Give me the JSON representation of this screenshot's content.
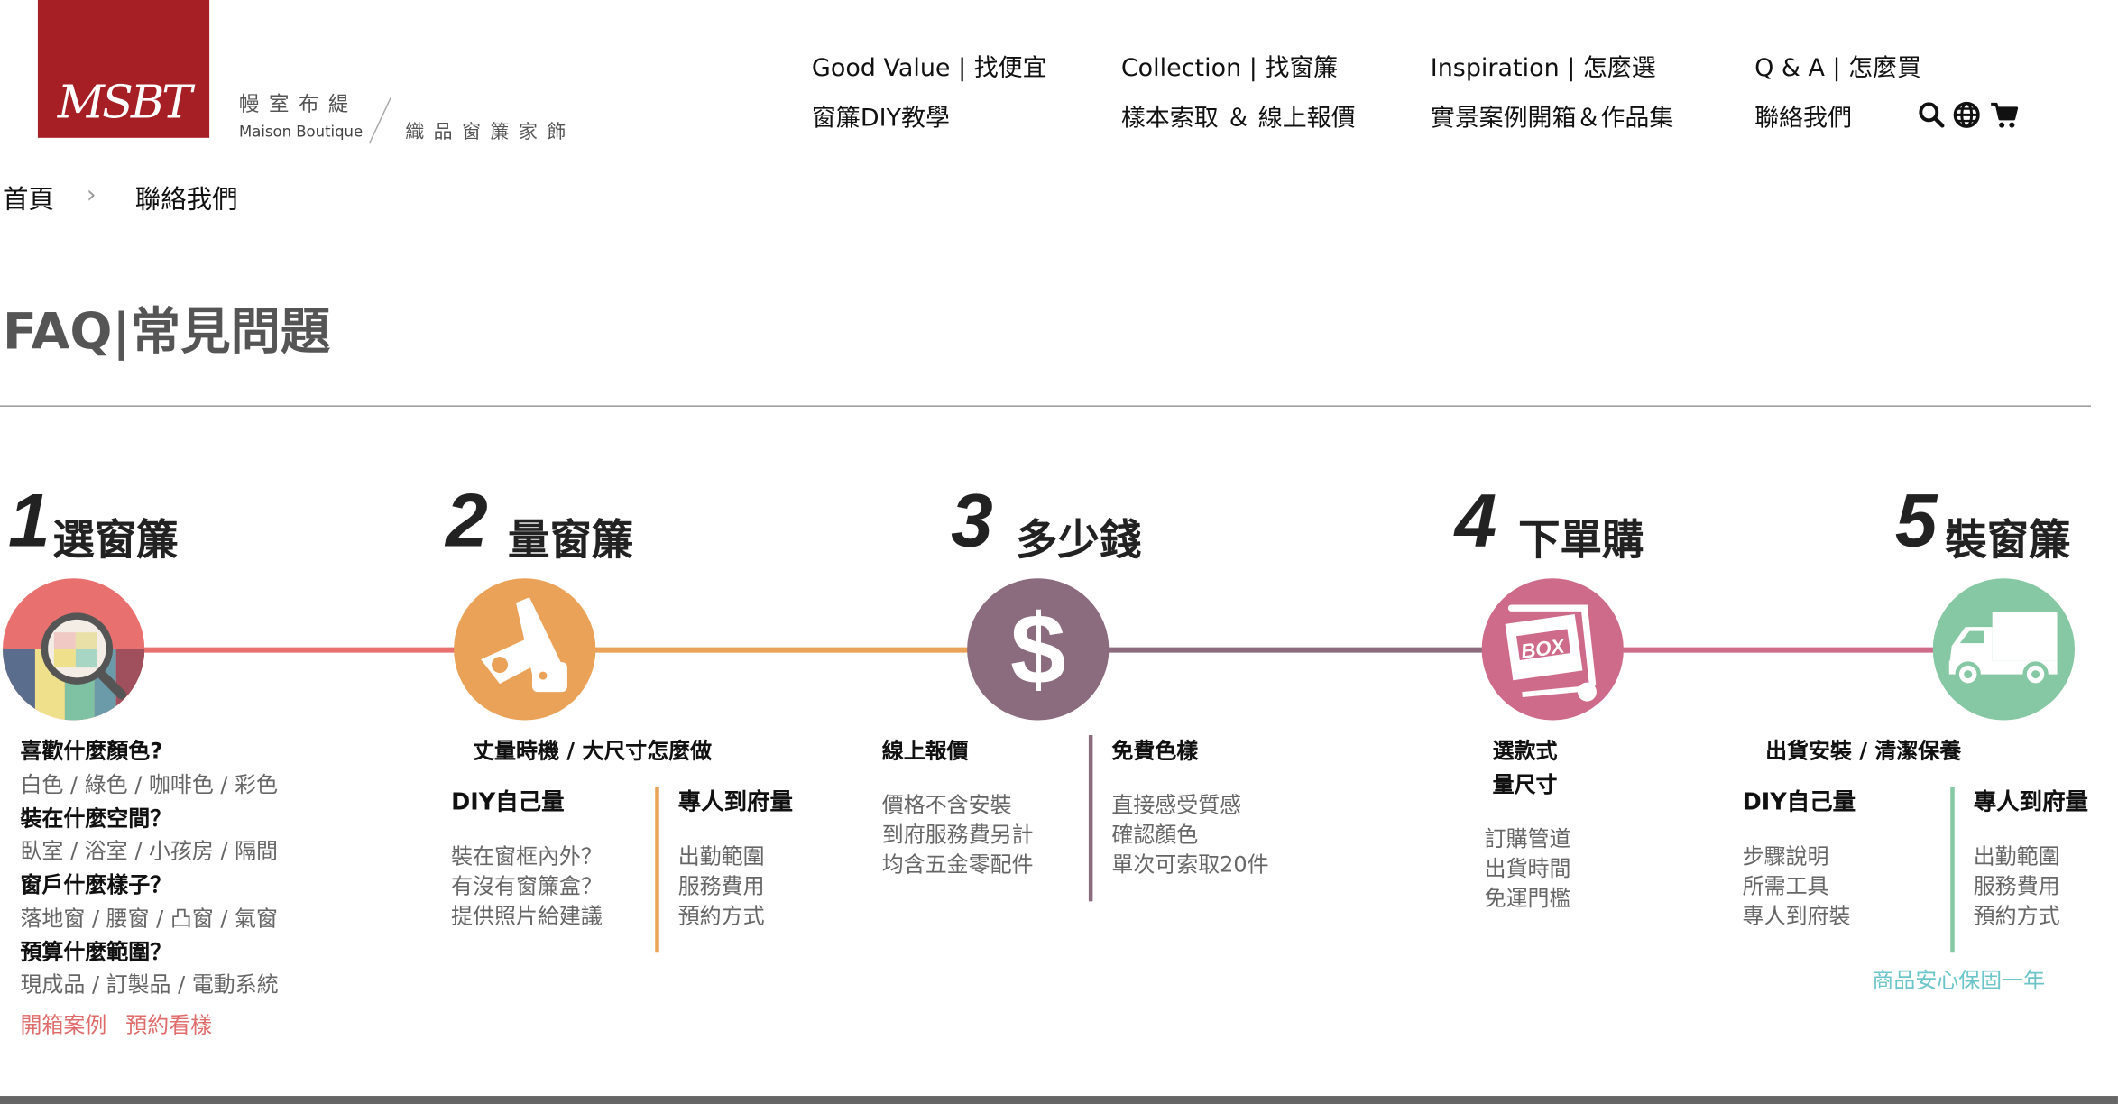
{
  "brand": {
    "logo_text": "MSBT",
    "name_cn": "幔室布緹",
    "name_en": "Maison Boutique",
    "tagline": "織品窗簾家飾"
  },
  "nav": {
    "row1": [
      "Good Value | 找便宜",
      "Collection | 找窗簾",
      "Inspiration | 怎麼選",
      "Q & A | 怎麼買"
    ],
    "row2": [
      "窗簾DIY教學",
      "樣本索取 ＆ 線上報價",
      "實景案例開箱＆作品集",
      "聯絡我們"
    ],
    "icons": [
      "search-icon",
      "globe-icon",
      "cart-icon"
    ]
  },
  "breadcrumb": {
    "home": "首頁",
    "separator": "›",
    "current": "聯絡我們"
  },
  "page_title": "FAQ|常見問題",
  "colors": {
    "brand_red": "#a51f25",
    "step1": "#e8716f",
    "step2": "#e9a257",
    "step3": "#8b6b7e",
    "step4": "#cf6b8a",
    "step5": "#86c7a4",
    "link_red": "#e06b6b",
    "link_teal": "#6cc5c8"
  },
  "steps": [
    {
      "num": "1",
      "label": "選窗簾",
      "icon": "magnifier-swatch-icon",
      "questions": [
        {
          "q": "喜歡什麼顏色?",
          "a": "白色 / 綠色 / 咖啡色 / 彩色"
        },
        {
          "q": "裝在什麼空間？",
          "a": "臥室 / 浴室 / 小孩房 / 隔間"
        },
        {
          "q": "窗戶什麼樣子？",
          "a": "落地窗 / 腰窗 / 凸窗 / 氣窗"
        },
        {
          "q": "預算什麼範圍？",
          "a": "現成品 / 訂製品 / 電動系統"
        }
      ],
      "links": [
        "開箱案例",
        "預約看樣"
      ]
    },
    {
      "num": "2",
      "label": "量窗簾",
      "icon": "measure-tools-icon",
      "heading": "丈量時機 / 大尺寸怎麼做",
      "left": {
        "title": "DIY自己量",
        "items": [
          "裝在窗框內外？",
          "有沒有窗簾盒？",
          "提供照片給建議"
        ]
      },
      "right": {
        "title": "專人到府量",
        "items": [
          "出勤範圍",
          "服務費用",
          "預約方式"
        ]
      }
    },
    {
      "num": "3",
      "label": "多少錢",
      "icon": "dollar-icon",
      "left": {
        "title": "線上報價",
        "items": [
          "價格不含安裝",
          "到府服務費另計",
          "均含五金零配件"
        ]
      },
      "right": {
        "title": "免費色樣",
        "items": [
          "直接感受質感",
          "確認顏色",
          "單次可索取20件"
        ]
      }
    },
    {
      "num": "4",
      "label": "下單購",
      "icon": "box-cart-icon",
      "heading": [
        "選款式",
        "量尺寸"
      ],
      "items": [
        "訂購管道",
        "出貨時間",
        "免運門檻"
      ]
    },
    {
      "num": "5",
      "label": "裝窗簾",
      "icon": "truck-icon",
      "heading": "出貨安裝 / 清潔保養",
      "left": {
        "title": "DIY自己量",
        "items": [
          "步驟說明",
          "所需工具",
          "專人到府裝"
        ]
      },
      "right": {
        "title": "專人到府量",
        "items": [
          "出勤範圍",
          "服務費用",
          "預約方式"
        ]
      },
      "note": "商品安心保固一年"
    }
  ]
}
